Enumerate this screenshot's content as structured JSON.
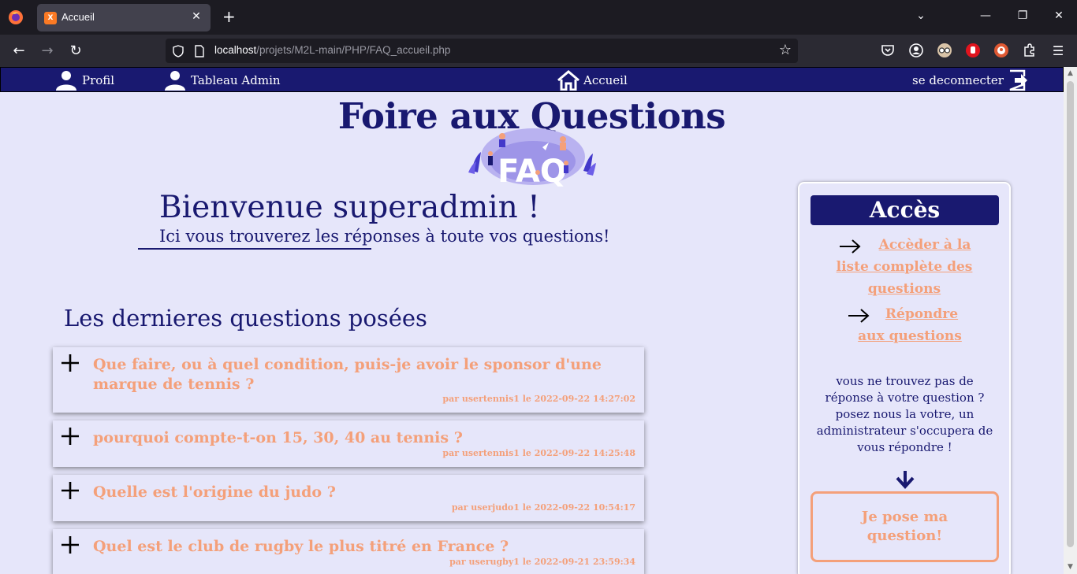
{
  "browser": {
    "tab_title": "Accueil",
    "url_host": "localhost",
    "url_path": "/projets/M2L-main/PHP/FAQ_accueil.php"
  },
  "header": {
    "profil": "Profil",
    "admin": "Tableau Admin",
    "home": "Accueil",
    "logout": "se deconnecter"
  },
  "main": {
    "title": "Foire aux Questions",
    "welcome": "Bienvenue superadmin !",
    "subtitle": "Ici vous trouverez les réponses à toute vos questions!",
    "latest_title": "Les dernieres questions posées",
    "questions": [
      {
        "text": "Que faire, ou à quel condition, puis-je avoir le sponsor d'une marque de tennis ?",
        "meta": "par usertennis1 le 2022-09-22 14:27:02"
      },
      {
        "text": "pourquoi compte-t-on 15, 30, 40 au tennis ?",
        "meta": "par usertennis1 le 2022-09-22 14:25:48"
      },
      {
        "text": "Quelle est l'origine du judo ?",
        "meta": "par userjudo1 le 2022-09-22 10:54:17"
      },
      {
        "text": "Quel est le club de rugby le plus titré en France ?",
        "meta": "par userugby1 le 2022-09-21 23:59:34"
      }
    ]
  },
  "access": {
    "title": "Accès",
    "link_list": "Accèder à la liste complète des questions",
    "link_answer": "Répondre aux questions",
    "info": "vous ne trouvez pas de réponse à votre question ? posez nous la votre, un administrateur s'occupera de vous répondre !",
    "ask_button": "Je pose ma question!"
  },
  "colors": {
    "navy": "#191970",
    "lavender": "#e6e6fa",
    "salmon": "#f4a07a"
  }
}
